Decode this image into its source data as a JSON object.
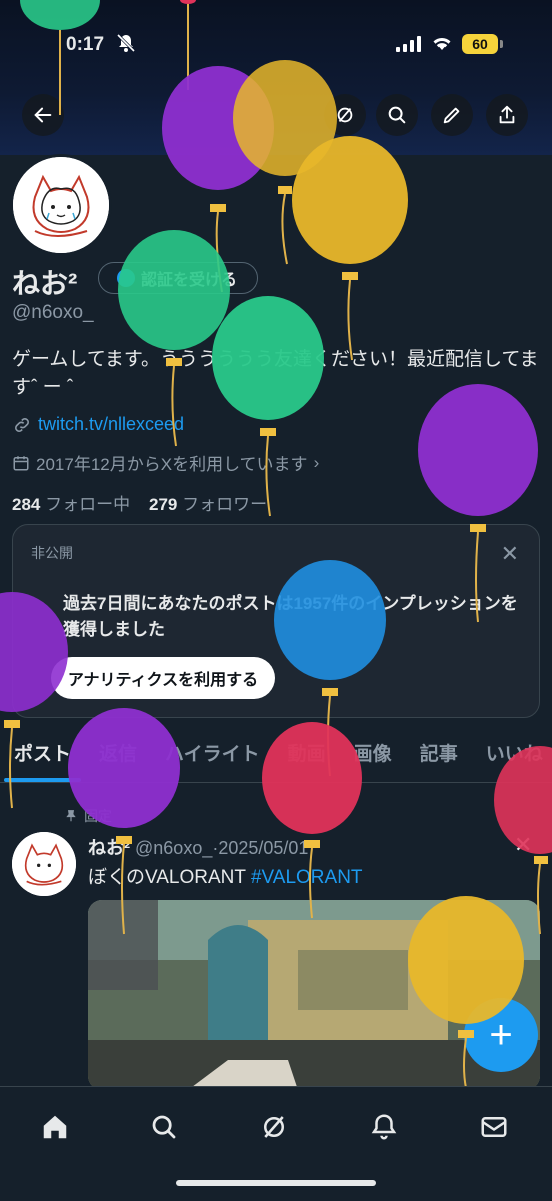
{
  "status_bar": {
    "time": "0:17",
    "battery": "60"
  },
  "profile": {
    "display_name": "ねお²",
    "verify_label": "認証を受ける",
    "handle": "@n6oxo_",
    "bio": "ゲームしてます。うううううう友達ください！最近配信してますˆ ー ˆ",
    "link": "twitch.tv/nllexceed",
    "joined": "2017年12月からXを利用しています",
    "following_count": "284",
    "following_label": "フォロー中",
    "followers_count": "279",
    "followers_label": "フォロワー"
  },
  "analytics_card": {
    "label": "非公開",
    "body": "過去7日間にあなたのポストは1957件のインプレッションを獲得しました",
    "button": "アナリティクスを利用する"
  },
  "tabs": [
    {
      "label": "ポスト"
    },
    {
      "label": "返信"
    },
    {
      "label": "ハイライト"
    },
    {
      "label": "動画"
    },
    {
      "label": "画像"
    },
    {
      "label": "記事"
    },
    {
      "label": "いいね"
    }
  ],
  "pinned_post": {
    "pinned_label": "固定",
    "author": "ねお²",
    "handle_date": "@n6oxo_·2025/05/01",
    "text": "ぼくのVALORANT",
    "hashtag": "#VALORANT"
  },
  "icons": [
    "back-icon",
    "explore-icon",
    "search-icon",
    "edit-icon",
    "share-icon",
    "home-icon",
    "grok-icon",
    "notifications-icon",
    "messages-icon",
    "plus-icon"
  ],
  "colors": {
    "accent": "#1d9bf0",
    "background": "#15202b"
  }
}
